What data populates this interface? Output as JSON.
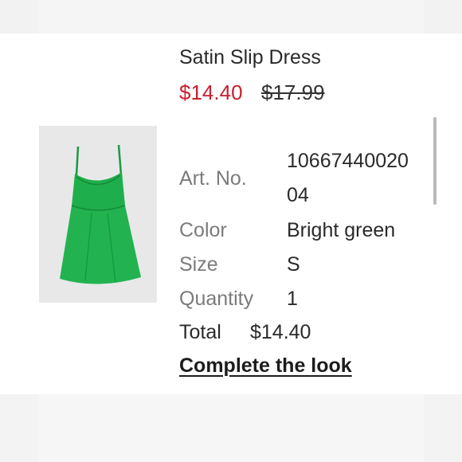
{
  "product": {
    "title": "Satin Slip Dress",
    "price_current": "$14.40",
    "price_original": "$17.99",
    "image_icon": "dress-image",
    "image_color": "#1fa84a"
  },
  "details": {
    "art_no_label": "Art. No.",
    "art_no_value_line1": "10667440020",
    "art_no_value_line2": "04",
    "color_label": "Color",
    "color_value": "Bright green",
    "size_label": "Size",
    "size_value": "S",
    "quantity_label": "Quantity",
    "quantity_value": "1"
  },
  "total": {
    "label": "Total",
    "value": "$14.40"
  },
  "actions": {
    "complete_look": "Complete the look"
  },
  "colors": {
    "sale_price": "#c8202e",
    "label_grey": "#7b7b7b"
  }
}
